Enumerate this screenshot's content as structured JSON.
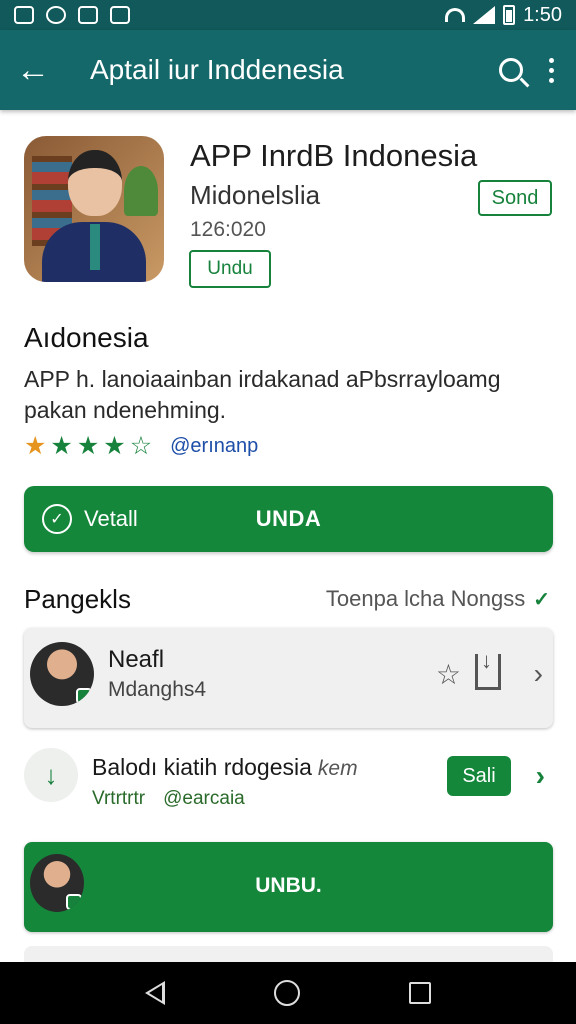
{
  "status_bar": {
    "time": "1:50"
  },
  "app_bar": {
    "title": "Aptail iur Inddenesia"
  },
  "app": {
    "name": "APP InrdB Indonesia",
    "developer": "Midonelslia",
    "size": "126:020",
    "action_label": "Undu",
    "send_label": "Sond"
  },
  "description": {
    "title": "Aıdonesia",
    "text": "APP h. lanoiaainban irdakanad aPbsrrayloamg pakan ndenehming.",
    "rating_stars": 4,
    "rating_max": 5,
    "rating_link": "@erınanp"
  },
  "install": {
    "left_label": "Vetall",
    "main_label": "UNDA"
  },
  "list": {
    "title": "Pangekls",
    "subtitle": "Toenpa lcha Nongss",
    "item1": {
      "name": "Neafl",
      "sub": "Mdanghs4"
    },
    "item2": {
      "name": "Balodı kiatih rdogesia",
      "tag": "kem",
      "stars": "Vrtrtrtr",
      "handle": "@earcaia",
      "button": "Sali"
    },
    "item3": {
      "label": "UNBU."
    }
  },
  "colors": {
    "app_bar": "#15686a",
    "status_bar": "#11595a",
    "accent_green": "#14873b",
    "link_blue": "#1d4ea8",
    "star_first": "#e69420"
  },
  "icons": [
    "back-arrow-icon",
    "search-icon",
    "more-vert-icon",
    "verified-icon",
    "check-icon",
    "star-icon",
    "download-icon",
    "chevron-right-icon",
    "nav-back-icon",
    "nav-home-icon",
    "nav-recents-icon"
  ]
}
